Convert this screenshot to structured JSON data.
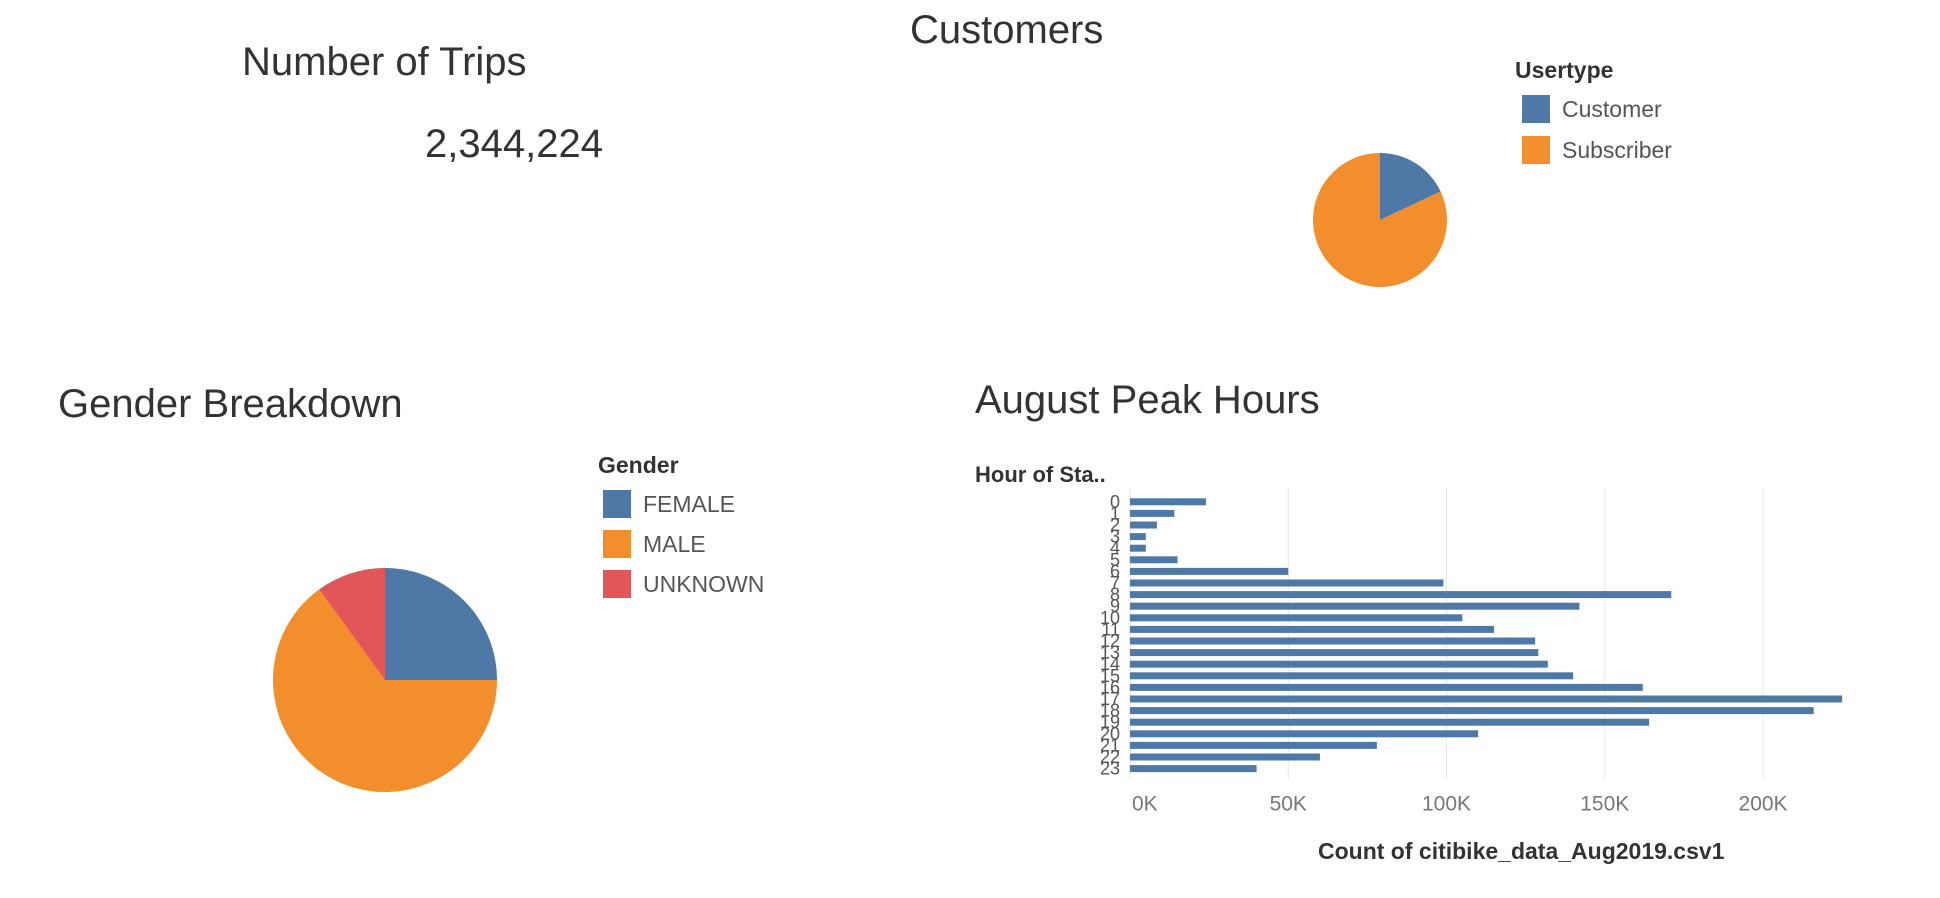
{
  "trips_panel": {
    "title": "Number of Trips",
    "value": "2,344,224"
  },
  "customers_panel": {
    "title": "Customers",
    "legend_title": "Usertype",
    "legend": [
      {
        "label": "Customer",
        "color": "#4E79A7"
      },
      {
        "label": "Subscriber",
        "color": "#F28E2B"
      }
    ]
  },
  "gender_panel": {
    "title": "Gender Breakdown",
    "legend_title": "Gender",
    "legend": [
      {
        "label": "FEMALE",
        "color": "#4E79A7"
      },
      {
        "label": "MALE",
        "color": "#F28E2B"
      },
      {
        "label": "UNKNOWN",
        "color": "#E15759"
      }
    ]
  },
  "peak_panel": {
    "title": "August Peak Hours",
    "row_header": "Hour of Sta..",
    "xlabel": "Count of citibike_data_Aug2019.csv1"
  },
  "chart_data": [
    {
      "type": "pie",
      "title": "Customers",
      "legend_title": "Usertype",
      "categories": [
        "Customer",
        "Subscriber"
      ],
      "values": [
        18,
        82
      ],
      "colors": [
        "#4E79A7",
        "#F28E2B"
      ]
    },
    {
      "type": "pie",
      "title": "Gender Breakdown",
      "legend_title": "Gender",
      "categories": [
        "FEMALE",
        "MALE",
        "UNKNOWN"
      ],
      "values": [
        25,
        65,
        10
      ],
      "colors": [
        "#4E79A7",
        "#F28E2B",
        "#E15759"
      ]
    },
    {
      "type": "bar",
      "orientation": "horizontal",
      "title": "August Peak Hours",
      "ylabel": "Hour of Sta..",
      "xlabel": "Count of citibike_data_Aug2019.csv1",
      "categories": [
        "0",
        "1",
        "2",
        "3",
        "4",
        "5",
        "6",
        "7",
        "8",
        "9",
        "10",
        "11",
        "12",
        "13",
        "14",
        "15",
        "16",
        "17",
        "18",
        "19",
        "20",
        "21",
        "22",
        "23"
      ],
      "values": [
        24000,
        14000,
        8500,
        5000,
        5000,
        15000,
        50000,
        99000,
        171000,
        142000,
        105000,
        115000,
        128000,
        129000,
        132000,
        140000,
        162000,
        225000,
        216000,
        164000,
        110000,
        78000,
        60000,
        40000
      ],
      "xlim": [
        0,
        230000
      ],
      "xticks": [
        0,
        50000,
        100000,
        150000,
        200000
      ],
      "xtick_labels": [
        "0K",
        "50K",
        "100K",
        "150K",
        "200K"
      ],
      "color": "#4E79A7",
      "grid": true
    }
  ]
}
